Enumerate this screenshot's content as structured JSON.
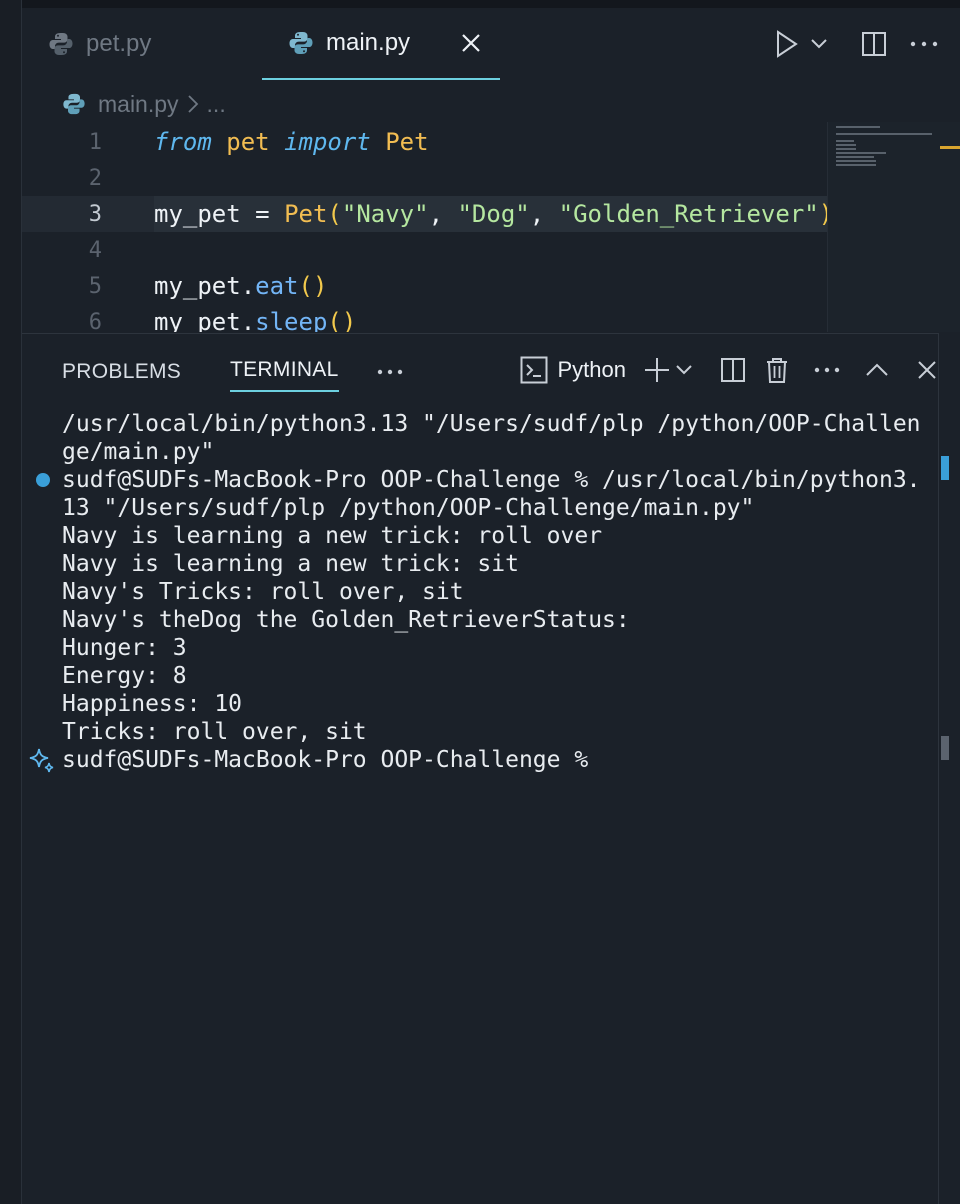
{
  "tabs": [
    {
      "label": "pet.py",
      "active": false
    },
    {
      "label": "main.py",
      "active": true
    }
  ],
  "breadcrumb": {
    "file": "main.py",
    "rest": "..."
  },
  "editor": {
    "line_numbers": [
      "1",
      "2",
      "3",
      "4",
      "5",
      "6"
    ],
    "current_line": "3",
    "lines": [
      [
        {
          "t": "from",
          "c": "k-it"
        },
        {
          "t": " ",
          "c": ""
        },
        {
          "t": "pet",
          "c": "k-mod"
        },
        {
          "t": " ",
          "c": ""
        },
        {
          "t": "import",
          "c": "k-it"
        },
        {
          "t": " ",
          "c": ""
        },
        {
          "t": "Pet",
          "c": "k-cls"
        }
      ],
      [],
      [
        {
          "t": "my_pet",
          "c": ""
        },
        {
          "t": " = ",
          "c": "k-op"
        },
        {
          "t": "Pet",
          "c": "k-cls"
        },
        {
          "t": "(",
          "c": "k-paren"
        },
        {
          "t": "\"Navy\"",
          "c": "k-str"
        },
        {
          "t": ", ",
          "c": ""
        },
        {
          "t": "\"Dog\"",
          "c": "k-str"
        },
        {
          "t": ", ",
          "c": ""
        },
        {
          "t": "\"Golden_Retriever\"",
          "c": "k-str"
        },
        {
          "t": ")",
          "c": "k-paren"
        }
      ],
      [],
      [
        {
          "t": "my_pet",
          "c": ""
        },
        {
          "t": ".",
          "c": ""
        },
        {
          "t": "eat",
          "c": "k-fn"
        },
        {
          "t": "()",
          "c": "k-paren"
        }
      ],
      [
        {
          "t": "my_pet",
          "c": ""
        },
        {
          "t": ".",
          "c": ""
        },
        {
          "t": "sleep",
          "c": "k-fn"
        },
        {
          "t": "()",
          "c": "k-paren"
        }
      ]
    ]
  },
  "panel": {
    "tabs": [
      "PROBLEMS",
      "TERMINAL"
    ],
    "active_tab": "TERMINAL",
    "more_label": "···",
    "shell_label": "Python"
  },
  "terminal": {
    "lines": [
      "/usr/local/bin/python3.13 \"/Users/sudf/plp /python/OOP-Challen",
      "ge/main.py\"",
      "sudf@SUDFs-MacBook-Pro OOP-Challenge % /usr/local/bin/python3.",
      "13 \"/Users/sudf/plp /python/OOP-Challenge/main.py\"",
      "Navy is learning a new trick: roll over",
      "Navy is learning a new trick: sit",
      "Navy's Tricks: roll over, sit",
      "Navy's theDog the Golden_RetrieverStatus:",
      "Hunger: 3",
      "Energy: 8",
      "Happiness: 10",
      "Tricks: roll over, sit",
      "sudf@SUDFs-MacBook-Pro OOP-Challenge %"
    ],
    "dot_line_index": 2,
    "sparkle_line_index": 12,
    "dot_color": "#3a9fd8"
  },
  "colors": {
    "background": "#1b2129",
    "accent": "#6dd0e0",
    "keyword": "#5fb8ef",
    "string": "#b5e7a0",
    "class": "#f2bd52"
  }
}
